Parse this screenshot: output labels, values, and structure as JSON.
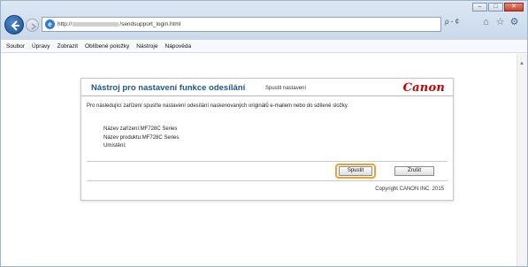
{
  "browser": {
    "url_prefix": "http://",
    "url_suffix": "/sendsupport_login.html",
    "search_glyph": "ρ - ¢",
    "menu": [
      "Soubor",
      "Úpravy",
      "Zobrazit",
      "Oblíbené položky",
      "Nástroje",
      "Nápověda"
    ]
  },
  "panel": {
    "title": "Nástroj pro nastavení funkce odesílání",
    "subtitle": "Spustit nastavení",
    "logo": "Canon",
    "description": "Pro následující zařízení spusťte nastavení odesílání naskenovaných originálů e-mailem nebo do sdílené složky.",
    "device_name": "Název zařízení:MF728C Series",
    "product_name": "Název produktu:MF728C Series",
    "location": "Umístění:",
    "run_label": "Spustit",
    "cancel_label": "Zrušit",
    "copyright": "Copyright CANON INC. 2015"
  },
  "colors": {
    "title": "#1d5591",
    "logo": "#cc0000",
    "highlight": "#f0a030"
  }
}
